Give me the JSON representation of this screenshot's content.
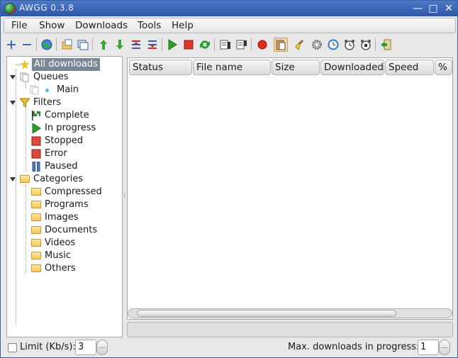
{
  "window": {
    "title": "AWGG 0.3.8",
    "controls": [
      "minimize-icon",
      "maximize-icon",
      "close-icon"
    ]
  },
  "menubar": {
    "items": [
      "File",
      "Show",
      "Downloads",
      "Tools",
      "Help"
    ]
  },
  "toolbar": {
    "buttons": [
      "add-download-icon",
      "remove-download-icon",
      "web-browser-icon",
      "open-file-icon",
      "open-folder-icon",
      "move-up-icon",
      "move-down-icon",
      "move-top-icon",
      "move-bottom-icon",
      "start-icon",
      "stop-icon",
      "restart-icon",
      "start-all-icon",
      "stop-all-icon",
      "record-icon",
      "clipboard-icon",
      "clean-icon",
      "settings-gear-icon",
      "scheduler-icon",
      "scheduler-start-icon",
      "scheduler-stop-icon",
      "exit-icon"
    ]
  },
  "tree": {
    "all_downloads": "All downloads",
    "queues": {
      "label": "Queues",
      "items": [
        "Main"
      ]
    },
    "filters": {
      "label": "Filters",
      "items": [
        "Complete",
        "In progress",
        "Stopped",
        "Error",
        "Paused"
      ]
    },
    "categories": {
      "label": "Categories",
      "items": [
        "Compressed",
        "Programs",
        "Images",
        "Documents",
        "Videos",
        "Music",
        "Others"
      ]
    }
  },
  "list": {
    "columns": [
      "Status",
      "File name",
      "Size",
      "Downloaded",
      "Speed",
      "%"
    ],
    "rows": []
  },
  "bottom": {
    "limit_label": "Limit (Kb/s):",
    "limit_value": "3",
    "limit_checked": false,
    "max_downloads_label": "Max. downloads in progress:",
    "max_downloads_value": "1"
  },
  "colors": {
    "titlebar": "#2d56a5",
    "selection": "#7a8796",
    "start_green": "#2aa02a",
    "stop_red": "#d83a2a"
  }
}
